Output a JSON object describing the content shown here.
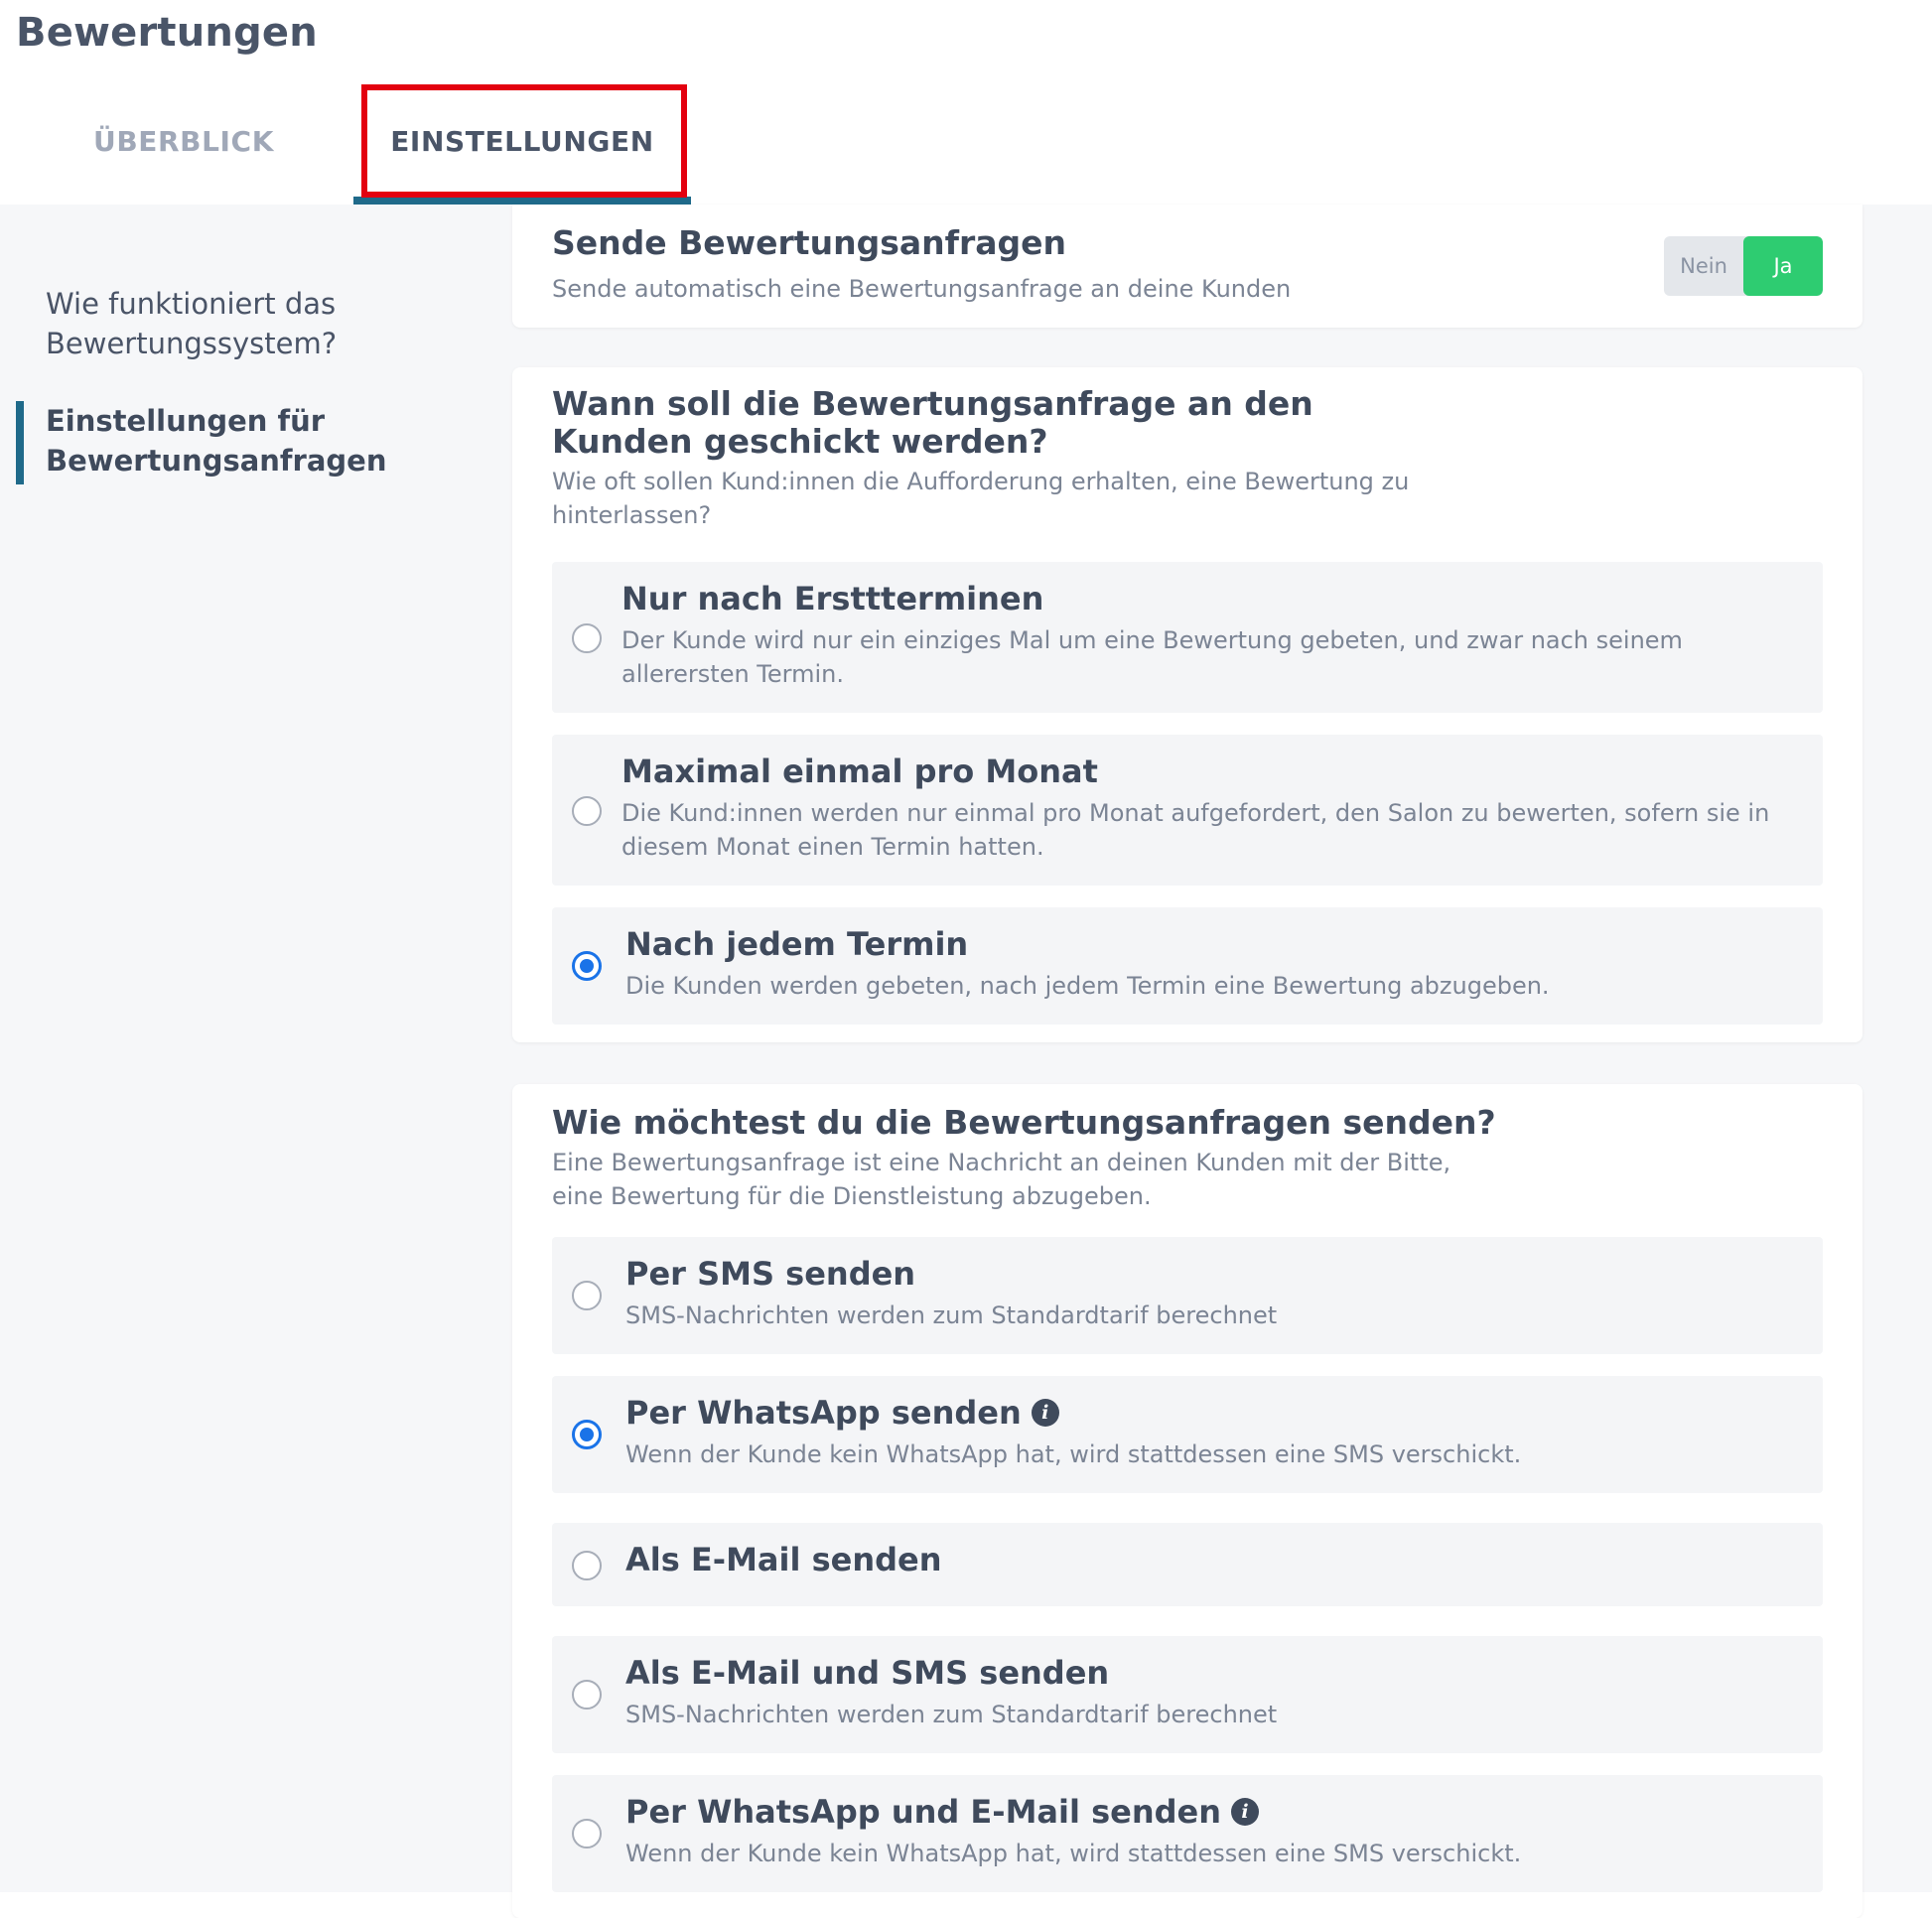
{
  "page": {
    "title": "Bewertungen"
  },
  "tabs": [
    {
      "label": "ÜBERBLICK",
      "active": false
    },
    {
      "label": "EINSTELLUNGEN",
      "active": true
    }
  ],
  "sidebar": {
    "items": [
      {
        "label": "Wie funktioniert das Bewertungssystem?",
        "active": false
      },
      {
        "label": "Einstellungen für Bewertungsanfragen",
        "active": true
      }
    ]
  },
  "send_requests": {
    "title": "Sende Bewertungsanfragen",
    "subtitle": "Sende automatisch eine Bewertungsanfrage an deine Kunden",
    "toggle": {
      "no_label": "Nein",
      "yes_label": "Ja",
      "value": "Ja"
    }
  },
  "when": {
    "title": "Wann soll die Bewertungsanfrage an den Kunden geschickt werden?",
    "subtitle": "Wie oft sollen Kund:innen die Aufforderung erhalten, eine Bewertung zu hinterlassen?",
    "options": [
      {
        "title": "Nur nach Ersttterminen",
        "desc": "Der Kunde wird nur ein einziges Mal um eine Bewertung gebeten, und zwar nach seinem allerersten Termin.",
        "checked": false
      },
      {
        "title": "Maximal einmal pro Monat",
        "desc": "Die Kund:innen werden nur einmal pro Monat aufgefordert, den Salon zu bewerten, sofern sie in diesem Monat einen Termin hatten.",
        "checked": false
      },
      {
        "title": "Nach jedem Termin",
        "desc": "Die Kunden werden gebeten, nach jedem Termin eine Bewertung abzugeben.",
        "checked": true
      }
    ]
  },
  "how": {
    "title": "Wie möchtest du die Bewertungsanfragen senden?",
    "subtitle": "Eine Bewertungsanfrage ist eine Nachricht an deinen Kunden mit der Bitte, eine Bewertung für die Dienstleistung abzugeben.",
    "options": [
      {
        "title": "Per SMS senden",
        "desc": "SMS-Nachrichten werden zum Standardtarif berechnet",
        "checked": false,
        "info_icon": false
      },
      {
        "title": "Per WhatsApp senden",
        "desc": "Wenn der Kunde kein WhatsApp hat, wird stattdessen eine SMS verschickt.",
        "checked": true,
        "info_icon": true
      },
      {
        "title": "Als E-Mail senden",
        "desc": "",
        "checked": false,
        "info_icon": false
      },
      {
        "title": "Als E-Mail und SMS senden",
        "desc": "SMS-Nachrichten werden zum Standardtarif berechnet",
        "checked": false,
        "info_icon": false
      },
      {
        "title": "Per WhatsApp und E-Mail senden",
        "desc": "Wenn der Kunde kein WhatsApp hat, wird stattdessen eine SMS verschickt.",
        "checked": false,
        "info_icon": true
      }
    ]
  },
  "icons": {
    "info": "info-icon",
    "radio_checked": "radio-checked",
    "radio_unchecked": "radio-unchecked"
  },
  "colors": {
    "accent": "#1f6a8a",
    "toggle_on": "#2ecc71",
    "radio": "#1a73e8",
    "highlight": "#e3000f"
  }
}
